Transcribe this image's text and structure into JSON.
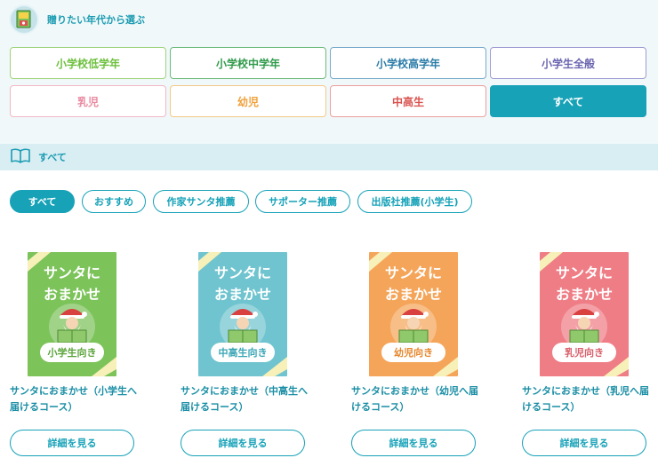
{
  "header": {
    "title": "贈りたい年代から選ぶ",
    "icon": "book-gift-icon"
  },
  "age_buttons": [
    {
      "label": "小学校低学年",
      "color": "#6cbf3d",
      "border": "#9fd47d"
    },
    {
      "label": "小学校中学年",
      "color": "#2f9a4a",
      "border": "#6dbb7c"
    },
    {
      "label": "小学校高学年",
      "color": "#2b7ca8",
      "border": "#79aacb"
    },
    {
      "label": "小学生全般",
      "color": "#6a64b0",
      "border": "#a09cd1"
    },
    {
      "label": "乳児",
      "color": "#e98aa0",
      "border": "#f2b7c5"
    },
    {
      "label": "幼児",
      "color": "#f0a13b",
      "border": "#f5c988"
    },
    {
      "label": "中高生",
      "color": "#d9534f",
      "border": "#eba09e"
    },
    {
      "label": "すべて",
      "color": "#ffffff",
      "border": "#17a2b8",
      "active": true
    }
  ],
  "section": {
    "title": "すべて",
    "icon": "open-book-icon"
  },
  "filters": [
    {
      "label": "すべて",
      "active": true
    },
    {
      "label": "おすすめ"
    },
    {
      "label": "作家サンタ推薦"
    },
    {
      "label": "サポーター推薦"
    },
    {
      "label": "出版社推薦(小学生)"
    }
  ],
  "cover_title_line1": "サンタに",
  "cover_title_line2": "おまかせ",
  "products": [
    {
      "badge": "小学生向き",
      "bg": "#7cc35a",
      "badge_color": "#5aa43a",
      "title": "サンタにおまかせ（小学生へ届けるコース）",
      "button": "詳細を見る"
    },
    {
      "badge": "中高生向き",
      "bg": "#6fc4cf",
      "badge_color": "#3aa6b5",
      "title": "サンタにおまかせ（中高生へ届けるコース）",
      "button": "詳細を見る"
    },
    {
      "badge": "幼児向き",
      "bg": "#f5a55a",
      "badge_color": "#e7862c",
      "title": "サンタにおまかせ（幼児へ届けるコース）",
      "button": "詳細を見る"
    },
    {
      "badge": "乳児向き",
      "bg": "#ef7d86",
      "badge_color": "#d95f6a",
      "title": "サンタにおまかせ（乳児へ届けるコース）",
      "button": "詳細を見る"
    }
  ]
}
